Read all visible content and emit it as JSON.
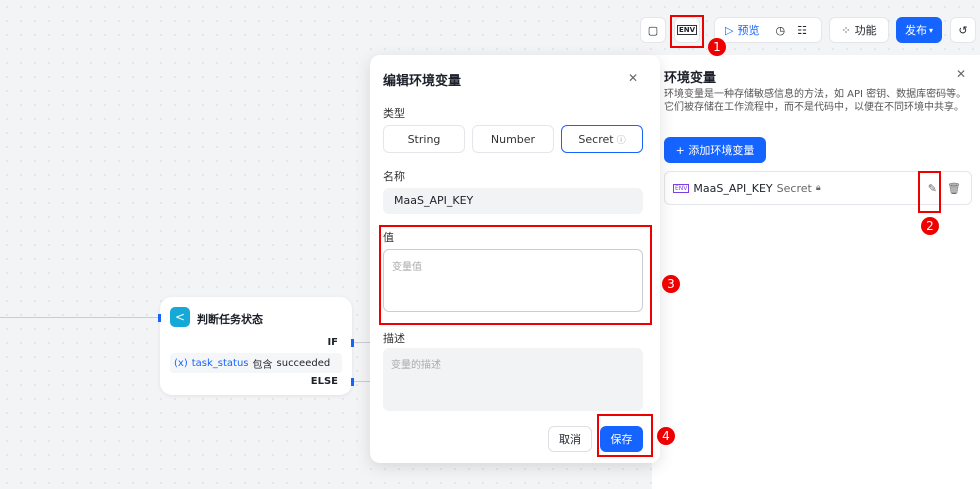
{
  "toolbar": {
    "preview": "预览",
    "features": "功能",
    "publish": "发布",
    "env_icon_text": "ENV"
  },
  "annotations": [
    "1",
    "2",
    "3",
    "4"
  ],
  "panel": {
    "title": "环境变量",
    "description": "环境变量是一种存储敏感信息的方法，如 API 密钥、数据库密码等。它们被存储在工作流程中，而不是代码中，以便在不同环境中共享。",
    "add_button": "+ 添加环境变量",
    "variables": [
      {
        "name": "MaaS_API_KEY",
        "type": "Secret"
      }
    ]
  },
  "dialog": {
    "title": "编辑环境变量",
    "type_label": "类型",
    "types": [
      "String",
      "Number",
      "Secret"
    ],
    "selected_type": "Secret",
    "name_label": "名称",
    "name_value": "MaaS_API_KEY",
    "value_label": "值",
    "value_placeholder": "变量值",
    "desc_label": "描述",
    "desc_placeholder": "变量的描述",
    "cancel": "取消",
    "save": "保存"
  },
  "node": {
    "title": "判断任务状态",
    "if_label": "IF",
    "else_label": "ELSE",
    "condition_var": "task_status",
    "condition_op": "包含",
    "condition_value": "succeeded",
    "var_icon": "(x)"
  },
  "colors": {
    "accent": "#1664ff",
    "annotation": "#e00000"
  }
}
